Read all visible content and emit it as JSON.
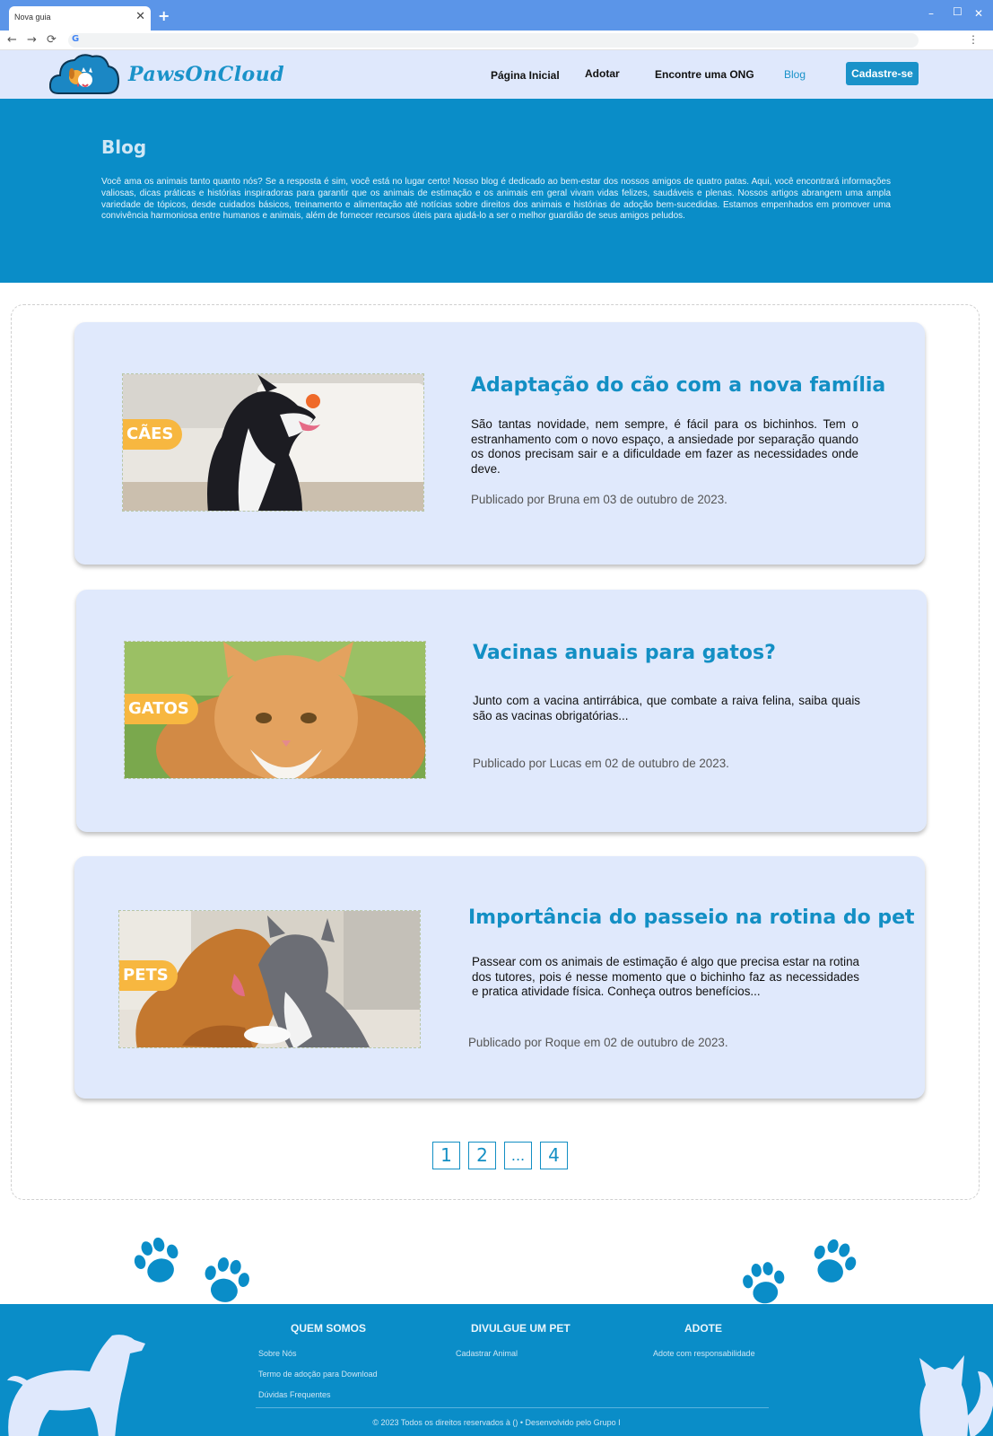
{
  "browser": {
    "tab_title": "Nova guia",
    "tab_close": "✕",
    "new_tab": "+",
    "back": "←",
    "forward": "→",
    "reload": "⟳",
    "minimize": "–",
    "maximize": "☐",
    "close": "✕",
    "menu": "⋮",
    "google_g": "G"
  },
  "header": {
    "logo_text": "PawsOnCloud",
    "nav": [
      "Página Inicial",
      "Adotar",
      "Encontre uma ONG",
      "Blog"
    ],
    "active_nav": "Blog",
    "signup_label": "Cadastre-se"
  },
  "hero": {
    "title": "Blog",
    "description": "Você ama os animais tanto quanto nós? Se a resposta é sim, você está no lugar certo! Nosso blog é dedicado ao bem-estar dos nossos amigos de quatro patas. Aqui, você encontrará informações valiosas, dicas práticas e histórias inspiradoras para garantir que os animais de estimação e os animais em geral vivam vidas felizes, saudáveis e plenas. Nossos artigos abrangem uma ampla variedade de tópicos, desde cuidados básicos, treinamento e alimentação até notícias sobre direitos dos animais e histórias de adoção bem-sucedidas. Estamos empenhados em promover uma convivência harmoniosa entre humanos e animais, além de fornecer recursos úteis para ajudá-lo a ser o melhor guardião de seus amigos peludos."
  },
  "posts": [
    {
      "badge": "CÃES",
      "title": "Adaptação do cão com a nova família",
      "excerpt": "  São tantas novidade, nem sempre, é fácil para os bichinhos. Tem o estranhamento com o novo espaço, a ansiedade por separação quando os donos precisam sair e a dificuldade em fazer as necessidades onde deve.",
      "meta": "Publicado por Bruna em 03 de outubro de 2023."
    },
    {
      "badge": "GATOS",
      "title": "Vacinas anuais para gatos?",
      "excerpt": "Junto com a vacina antirrábica, que combate a raiva felina, saiba quais são as vacinas obrigatórias...",
      "meta": "Publicado por Lucas em 02 de outubro de 2023."
    },
    {
      "badge": "PETS",
      "title": "Importância do passeio na rotina do pet",
      "excerpt": "Passear com os animais de estimação é algo que precisa estar na rotina dos tutores, pois é nesse momento que o bichinho faz as necessidades e pratica atividade física. Conheça outros benefícios...",
      "meta": "Publicado por Roque em 02 de outubro de 2023."
    }
  ],
  "pagination": [
    "1",
    "2",
    "...",
    "4"
  ],
  "footer": {
    "columns": [
      {
        "heading": "QUEM SOMOS",
        "links": [
          "Sobre Nós",
          "Termo de adoção para Download",
          "Dúvidas Frequentes"
        ]
      },
      {
        "heading": "DIVULGUE UM PET",
        "links": [
          "Cadastrar Animal"
        ]
      },
      {
        "heading": "ADOTE",
        "links": [
          "Adote com responsabilidade"
        ]
      }
    ],
    "copyright": "© 2023 Todos os direitos reservados à () • Desenvolvido pelo Grupo I"
  },
  "colors": {
    "brand_blue": "#0a8dc8",
    "title_blue": "#138fc4",
    "card_bg": "#e0e9fc",
    "badge_orange": "#f7b740"
  }
}
